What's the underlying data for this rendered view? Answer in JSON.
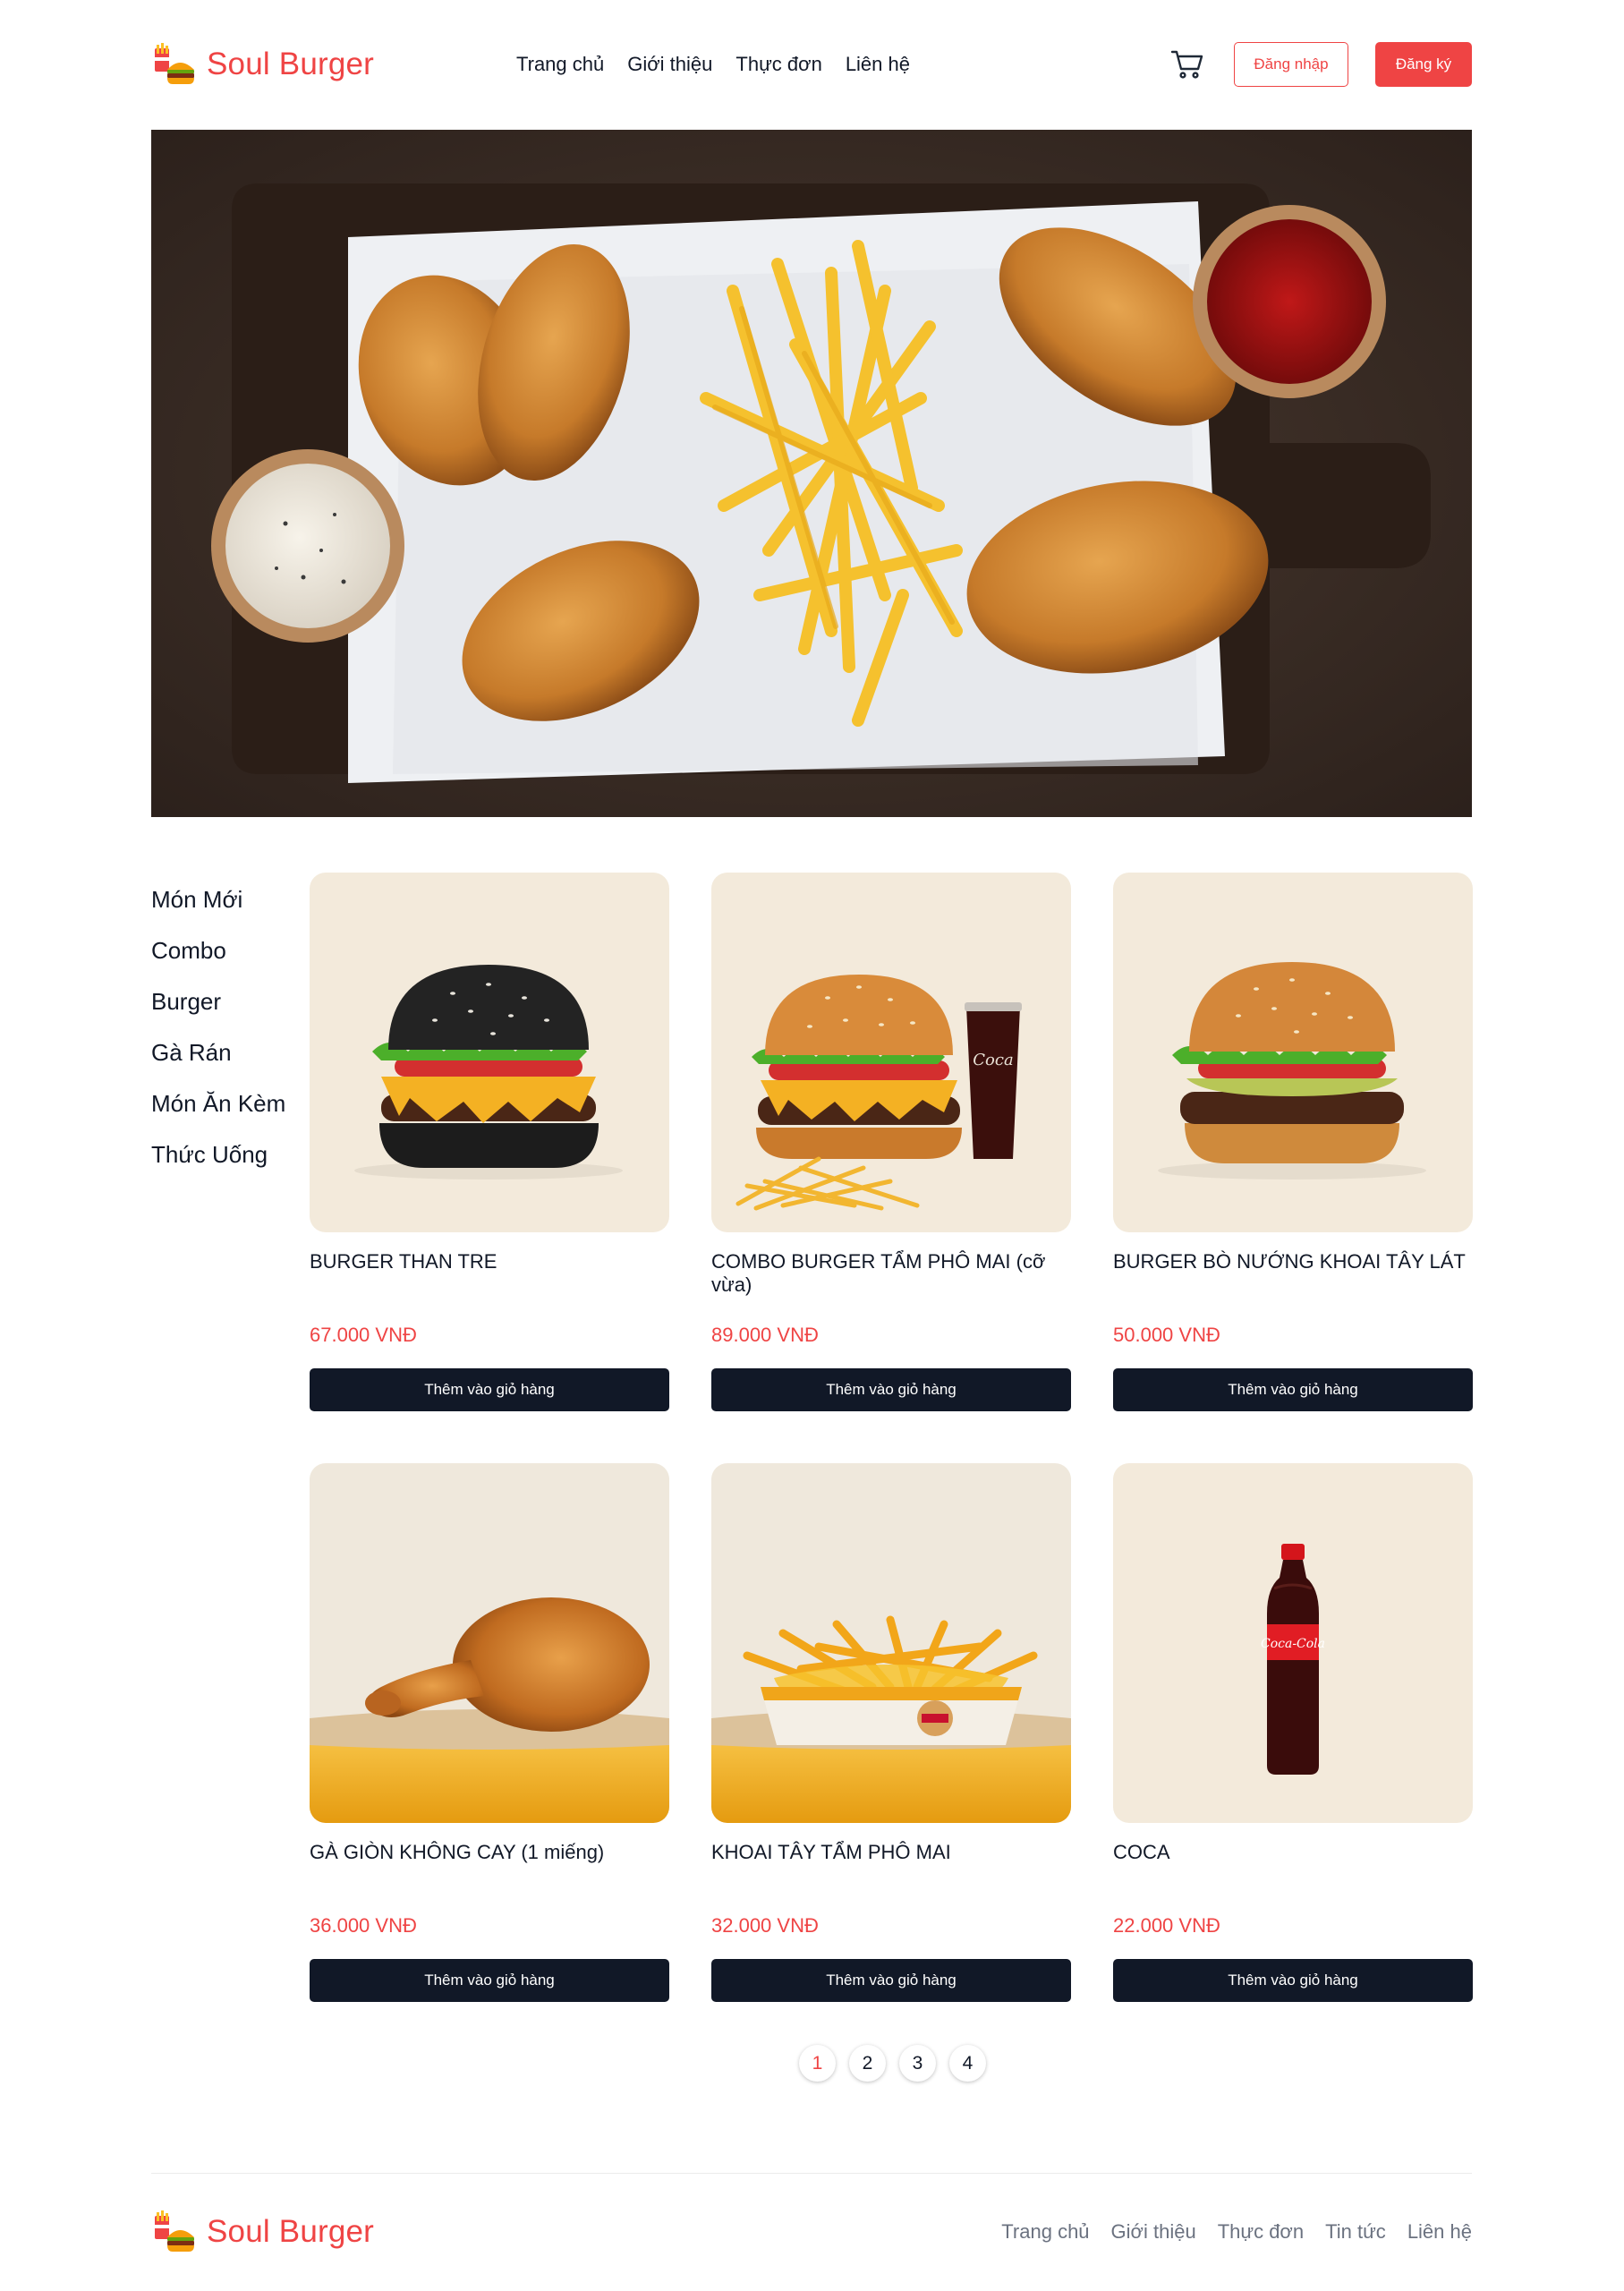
{
  "brand": {
    "name": "Soul Burger",
    "color": "#ef4444"
  },
  "nav": [
    {
      "label": "Trang chủ"
    },
    {
      "label": "Giới thiệu"
    },
    {
      "label": "Thực đơn"
    },
    {
      "label": "Liên hệ"
    }
  ],
  "header": {
    "cart_icon": "cart-icon",
    "login_label": "Đăng nhập",
    "register_label": "Đăng ký"
  },
  "sidebar": {
    "categories": [
      {
        "label": "Món Mới"
      },
      {
        "label": "Combo"
      },
      {
        "label": "Burger"
      },
      {
        "label": "Gà Rán"
      },
      {
        "label": "Món Ăn Kèm"
      },
      {
        "label": "Thức Uống"
      }
    ]
  },
  "products": [
    {
      "name": "BURGER THAN TRE",
      "price": "67.000 VNĐ",
      "button": "Thêm vào giỏ hàng",
      "image": "black-bun-burger"
    },
    {
      "name": "COMBO BURGER TẨM PHÔ MAI (cỡ vừa)",
      "price": "89.000 VNĐ",
      "button": "Thêm vào giỏ hàng",
      "image": "burger-combo-with-coke-and-fries"
    },
    {
      "name": "BURGER BÒ NƯỚNG KHOAI TÂY LÁT",
      "price": "50.000 VNĐ",
      "button": "Thêm vào giỏ hàng",
      "image": "beef-burger"
    },
    {
      "name": "GÀ GIÒN KHÔNG CAY (1 miếng)",
      "price": "36.000 VNĐ",
      "button": "Thêm vào giỏ hàng",
      "image": "fried-chicken-drumstick"
    },
    {
      "name": "KHOAI TÂY TẨM PHÔ MAI",
      "price": "32.000 VNĐ",
      "button": "Thêm vào giỏ hàng",
      "image": "cheese-fries"
    },
    {
      "name": "COCA",
      "price": "22.000 VNĐ",
      "button": "Thêm vào giỏ hàng",
      "image": "coca-cola-bottle"
    }
  ],
  "pagination": {
    "pages": [
      "1",
      "2",
      "3",
      "4"
    ],
    "current": "1"
  },
  "footer": {
    "brand": "Soul Burger",
    "links": [
      {
        "label": "Trang chủ"
      },
      {
        "label": "Giới thiệu"
      },
      {
        "label": "Thực đơn"
      },
      {
        "label": "Tin tức"
      },
      {
        "label": "Liên hệ"
      }
    ]
  },
  "colors": {
    "accent": "#ef4444",
    "dark_button": "#111827",
    "card_bg": "#f3eadb"
  }
}
